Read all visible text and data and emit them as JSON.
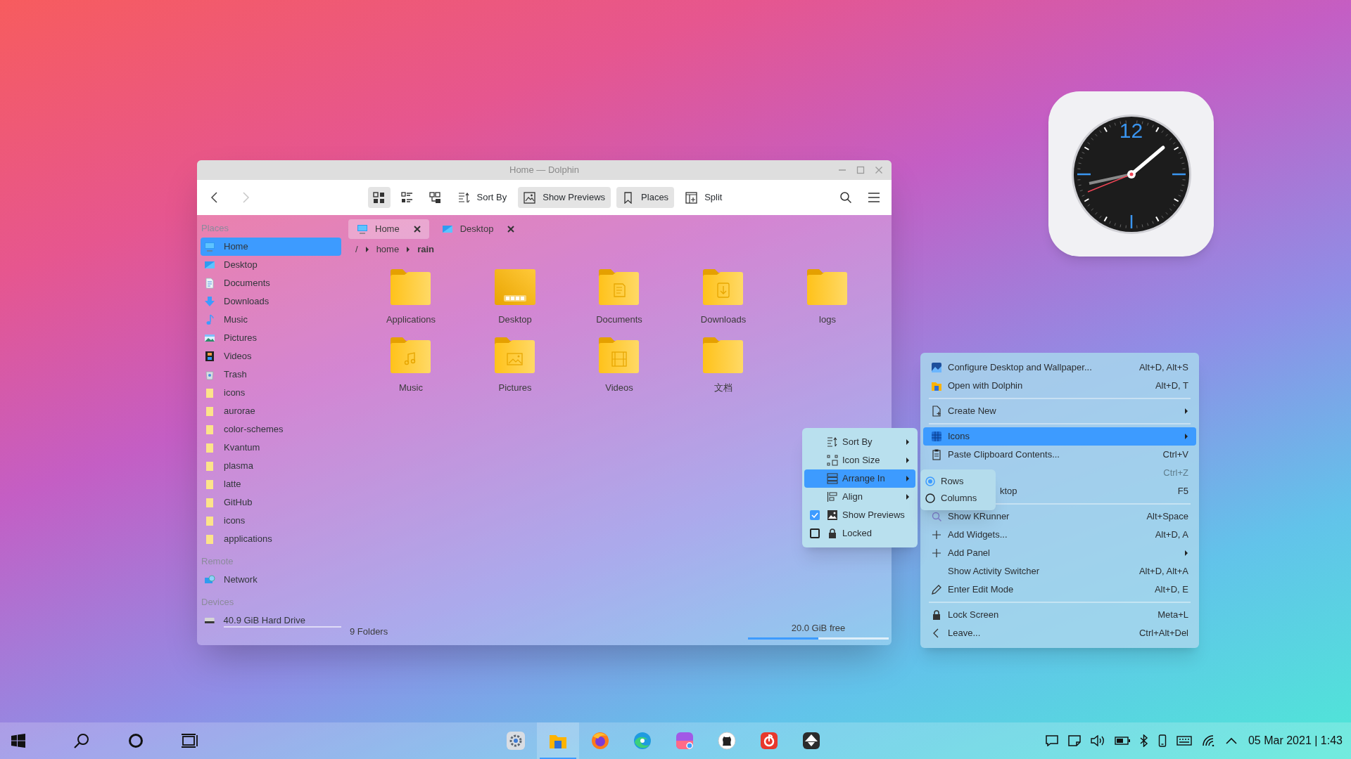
{
  "window": {
    "title": "Home — Dolphin",
    "navigation": [
      {
        "disabled": false
      },
      {
        "disabled": true
      }
    ],
    "view_modes": [
      {
        "selected": true
      },
      {
        "selected": false
      },
      {
        "selected": false
      }
    ],
    "toolbar": [
      {
        "label": "Sort By",
        "on": false
      },
      {
        "label": "Show Previews",
        "on": true
      },
      {
        "label": "Places",
        "on": true
      },
      {
        "label": "Split",
        "on": false
      }
    ],
    "sidebar": {
      "sections": [
        {
          "title": "Places",
          "items": [
            {
              "label": "Home",
              "kind": "home",
              "selected": true
            },
            {
              "label": "Desktop",
              "kind": "desktop",
              "selected": false
            },
            {
              "label": "Documents",
              "kind": "documents",
              "selected": false
            },
            {
              "label": "Downloads",
              "kind": "downloads",
              "selected": false
            },
            {
              "label": "Music",
              "kind": "music",
              "selected": false
            },
            {
              "label": "Pictures",
              "kind": "pictures",
              "selected": false
            },
            {
              "label": "Videos",
              "kind": "videos",
              "selected": false
            },
            {
              "label": "Trash",
              "kind": "trash",
              "selected": false
            },
            {
              "label": "icons",
              "kind": "folder",
              "selected": false
            },
            {
              "label": "aurorae",
              "kind": "folder",
              "selected": false
            },
            {
              "label": "color-schemes",
              "kind": "folder",
              "selected": false
            },
            {
              "label": "Kvantum",
              "kind": "folder",
              "selected": false
            },
            {
              "label": "plasma",
              "kind": "folder",
              "selected": false
            },
            {
              "label": "latte",
              "kind": "folder",
              "selected": false
            },
            {
              "label": "GitHub",
              "kind": "folder",
              "selected": false
            },
            {
              "label": "icons",
              "kind": "folder",
              "selected": false
            },
            {
              "label": "applications",
              "kind": "folder",
              "selected": false
            }
          ]
        },
        {
          "title": "Remote",
          "items": [
            {
              "label": "Network",
              "kind": "network",
              "selected": false
            }
          ]
        },
        {
          "title": "Devices",
          "items": [
            {
              "label": "40.9 GiB Hard Drive",
              "kind": "drive",
              "selected": false
            }
          ]
        }
      ]
    },
    "tabs": [
      {
        "label": "Home",
        "kind": "home",
        "selected": true
      },
      {
        "label": "Desktop",
        "kind": "desktop",
        "selected": false
      }
    ],
    "breadcrumb": [
      "/",
      "home",
      "rain"
    ],
    "files": [
      {
        "name": "Applications",
        "kind": "plain"
      },
      {
        "name": "Desktop",
        "kind": "desktop"
      },
      {
        "name": "Documents",
        "kind": "documents"
      },
      {
        "name": "Downloads",
        "kind": "downloads"
      },
      {
        "name": "logs",
        "kind": "plain"
      },
      {
        "name": "Music",
        "kind": "music"
      },
      {
        "name": "Pictures",
        "kind": "pictures"
      },
      {
        "name": "Videos",
        "kind": "videos"
      },
      {
        "name": "文档",
        "kind": "plain"
      }
    ],
    "status_bar": {
      "summary": "9 Folders",
      "free_space": "20.0 GiB free",
      "level": 0.5
    }
  },
  "clock": {
    "numeral": "12"
  },
  "icons_submenu": {
    "items": [
      {
        "kind": "submenu",
        "label": "Sort By",
        "selected": false
      },
      {
        "kind": "submenu",
        "label": "Icon Size",
        "selected": false
      },
      {
        "kind": "submenu",
        "label": "Arrange In",
        "selected": true
      },
      {
        "kind": "submenu",
        "label": "Align",
        "selected": false
      },
      {
        "kind": "checkbox",
        "label": "Show Previews",
        "checked": true,
        "selected": false
      },
      {
        "kind": "checkbox",
        "label": "Locked",
        "checked": false,
        "selected": false
      }
    ]
  },
  "arrange_submenu": {
    "items": [
      {
        "label": "Rows",
        "selected": true
      },
      {
        "label": "Columns",
        "selected": false
      }
    ]
  },
  "desktop_menu": {
    "items": [
      {
        "kind": "action",
        "label": "Configure Desktop and Wallpaper...",
        "shortcut": "Alt+D, Alt+S",
        "submenu": false,
        "selected": false,
        "disabled": false
      },
      {
        "kind": "action",
        "label": "Open with Dolphin",
        "shortcut": "Alt+D, T",
        "submenu": false,
        "selected": false,
        "disabled": false
      },
      {
        "kind": "separator"
      },
      {
        "kind": "action",
        "label": "Create New",
        "submenu": true,
        "selected": false,
        "disabled": false
      },
      {
        "kind": "separator"
      },
      {
        "kind": "action",
        "label": "Icons",
        "submenu": true,
        "selected": true,
        "disabled": false
      },
      {
        "kind": "action",
        "label": "Paste Clipboard Contents...",
        "shortcut": "Ctrl+V",
        "submenu": false,
        "selected": false,
        "disabled": false
      },
      {
        "kind": "action",
        "shortcut": "Ctrl+Z",
        "submenu": false,
        "selected": false,
        "disabled": true
      },
      {
        "kind": "covered",
        "label": "ktop",
        "shortcut": "F5",
        "submenu": false,
        "selected": false,
        "disabled": false
      },
      {
        "kind": "separator"
      },
      {
        "kind": "action",
        "label": "Show KRunner",
        "shortcut": "Alt+Space",
        "submenu": false,
        "selected": false,
        "disabled": false
      },
      {
        "kind": "action",
        "label": "Add Widgets...",
        "shortcut": "Alt+D, A",
        "submenu": false,
        "selected": false,
        "disabled": false
      },
      {
        "kind": "action",
        "label": "Add Panel",
        "submenu": true,
        "selected": false,
        "disabled": false
      },
      {
        "kind": "action",
        "label": "Show Activity Switcher",
        "shortcut": "Alt+D, Alt+A",
        "submenu": false,
        "selected": false,
        "disabled": false
      },
      {
        "kind": "action",
        "label": "Enter Edit Mode",
        "shortcut": "Alt+D, E",
        "submenu": false,
        "selected": false,
        "disabled": false
      },
      {
        "kind": "separator"
      },
      {
        "kind": "action",
        "label": "Lock Screen",
        "shortcut": "Meta+L",
        "submenu": false,
        "selected": false,
        "disabled": false
      },
      {
        "kind": "action",
        "label": "Leave...",
        "shortcut": "Ctrl+Alt+Del",
        "submenu": false,
        "selected": false,
        "disabled": false
      }
    ]
  },
  "taskbar": {
    "apps": [
      {
        "kind": "settings",
        "selected": false
      },
      {
        "kind": "files",
        "selected": true
      },
      {
        "kind": "firefox",
        "selected": false
      },
      {
        "kind": "edge",
        "selected": false
      },
      {
        "kind": "store",
        "selected": false
      },
      {
        "kind": "github",
        "selected": false
      },
      {
        "kind": "music",
        "selected": false
      },
      {
        "kind": "inkscape",
        "selected": false
      }
    ],
    "datetime": "05 Mar 2021 | 1:43"
  }
}
